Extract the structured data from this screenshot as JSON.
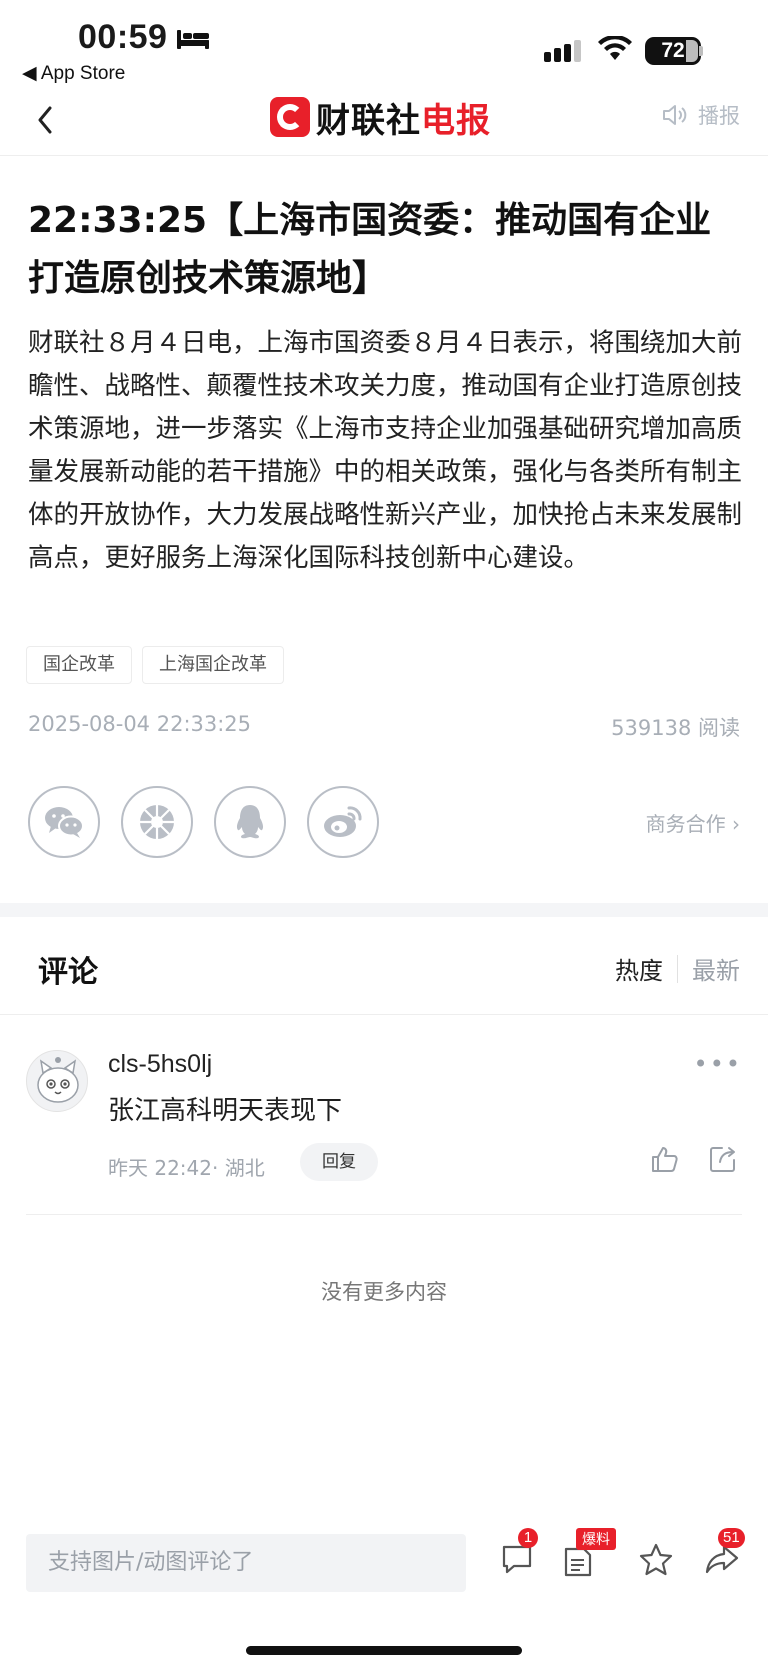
{
  "status_bar": {
    "time": "00:59",
    "back_app": "◀ App Store",
    "battery": "72"
  },
  "nav": {
    "brand_black": "财联社",
    "brand_red": "电报",
    "broadcast_label": "播报"
  },
  "article": {
    "headline": "22:33:25【上海市国资委：推动国有企业打造原创技术策源地】",
    "body": "财联社８月４日电，上海市国资委８月４日表示，将围绕加大前瞻性、战略性、颠覆性技术攻关力度，推动国有企业打造原创技术策源地，进一步落实《上海市支持企业加强基础研究增加高质量发展新动能的若干措施》中的相关政策，强化与各类所有制主体的开放协作，大力发展战略性新兴产业，加快抢占未来发展制高点，更好服务上海深化国际科技创新中心建设。",
    "tags": [
      "国企改革",
      "上海国企改革"
    ],
    "datetime": "2025-08-04 22:33:25",
    "reads": "539138 阅读",
    "business_link": "商务合作 ›"
  },
  "share_icons": [
    "wechat-icon",
    "moments-icon",
    "qq-icon",
    "weibo-icon"
  ],
  "comments": {
    "title": "评论",
    "sort_hot": "热度",
    "sort_new": "最新",
    "items": [
      {
        "user": "cls-5hs0lj",
        "text": "张江高科明天表现下",
        "meta": "昨天 22:42· 湖北",
        "reply_label": "回复"
      }
    ],
    "no_more": "没有更多内容"
  },
  "bottom_bar": {
    "input_placeholder": "支持图片/动图评论了",
    "comment_badge": "1",
    "baoliao_label": "爆料",
    "share_badge": "51"
  },
  "colors": {
    "brand_red": "#e8202a",
    "muted_gray": "#a8aeb6"
  }
}
